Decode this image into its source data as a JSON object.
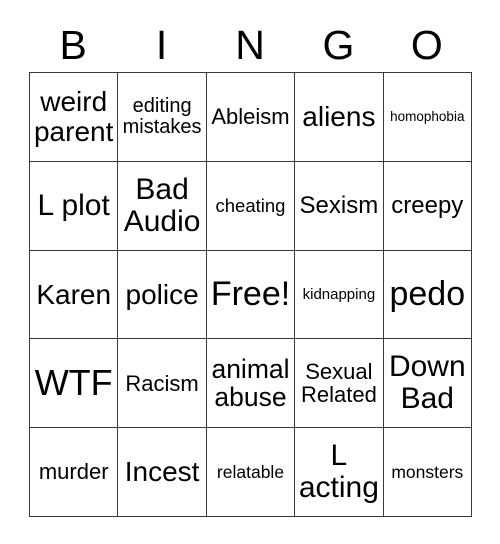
{
  "card": {
    "title": "BINGO",
    "columns": [
      "B",
      "I",
      "N",
      "G",
      "O"
    ],
    "free_space_label": "Free!",
    "free_space_position": {
      "row": 3,
      "column": 3
    },
    "grid_size": "5x5",
    "colors": {
      "background": "#ffffff",
      "text": "#000000",
      "border": "#3a3a3a"
    },
    "rows": [
      {
        "cells": [
          {
            "text": "weird parent",
            "size": "fs-28",
            "lines": 2,
            "free": false
          },
          {
            "text": "editing mistakes",
            "size": "fs-20",
            "lines": 2,
            "free": false
          },
          {
            "text": "Ableism",
            "size": "fs-22",
            "lines": 1,
            "free": false
          },
          {
            "text": "aliens",
            "size": "fs-28",
            "lines": 1,
            "free": false
          },
          {
            "text": "homophobia",
            "size": "fs-13",
            "lines": 1,
            "free": false
          }
        ]
      },
      {
        "cells": [
          {
            "text": "L plot",
            "size": "fs-30",
            "lines": 2,
            "free": false
          },
          {
            "text": "Bad Audio",
            "size": "fs-30",
            "lines": 2,
            "free": false
          },
          {
            "text": "cheating",
            "size": "fs-18",
            "lines": 1,
            "free": false
          },
          {
            "text": "Sexism",
            "size": "fs-24",
            "lines": 1,
            "free": false
          },
          {
            "text": "creepy",
            "size": "fs-24",
            "lines": 1,
            "free": false
          }
        ]
      },
      {
        "cells": [
          {
            "text": "Karen",
            "size": "fs-28",
            "lines": 1,
            "free": false
          },
          {
            "text": "police",
            "size": "fs-28",
            "lines": 1,
            "free": false
          },
          {
            "text": "Free!",
            "size": "fs-34",
            "lines": 1,
            "free": true
          },
          {
            "text": "kidnapping",
            "size": "fs-15",
            "lines": 1,
            "free": false
          },
          {
            "text": "pedo",
            "size": "fs-34",
            "lines": 1,
            "free": false
          }
        ]
      },
      {
        "cells": [
          {
            "text": "WTF",
            "size": "fs-36",
            "lines": 1,
            "free": false
          },
          {
            "text": "Racism",
            "size": "fs-22",
            "lines": 1,
            "free": false
          },
          {
            "text": "animal abuse",
            "size": "fs-26",
            "lines": 2,
            "free": false
          },
          {
            "text": "Sexual Related",
            "size": "fs-22",
            "lines": 2,
            "free": false
          },
          {
            "text": "Down Bad",
            "size": "fs-30",
            "lines": 2,
            "free": false
          }
        ]
      },
      {
        "cells": [
          {
            "text": "murder",
            "size": "fs-22",
            "lines": 1,
            "free": false
          },
          {
            "text": "Incest",
            "size": "fs-28",
            "lines": 1,
            "free": false
          },
          {
            "text": "relatable",
            "size": "fs-17",
            "lines": 1,
            "free": false
          },
          {
            "text": "L acting",
            "size": "fs-30",
            "lines": 2,
            "free": false
          },
          {
            "text": "monsters",
            "size": "fs-17",
            "lines": 1,
            "free": false
          }
        ]
      }
    ]
  }
}
